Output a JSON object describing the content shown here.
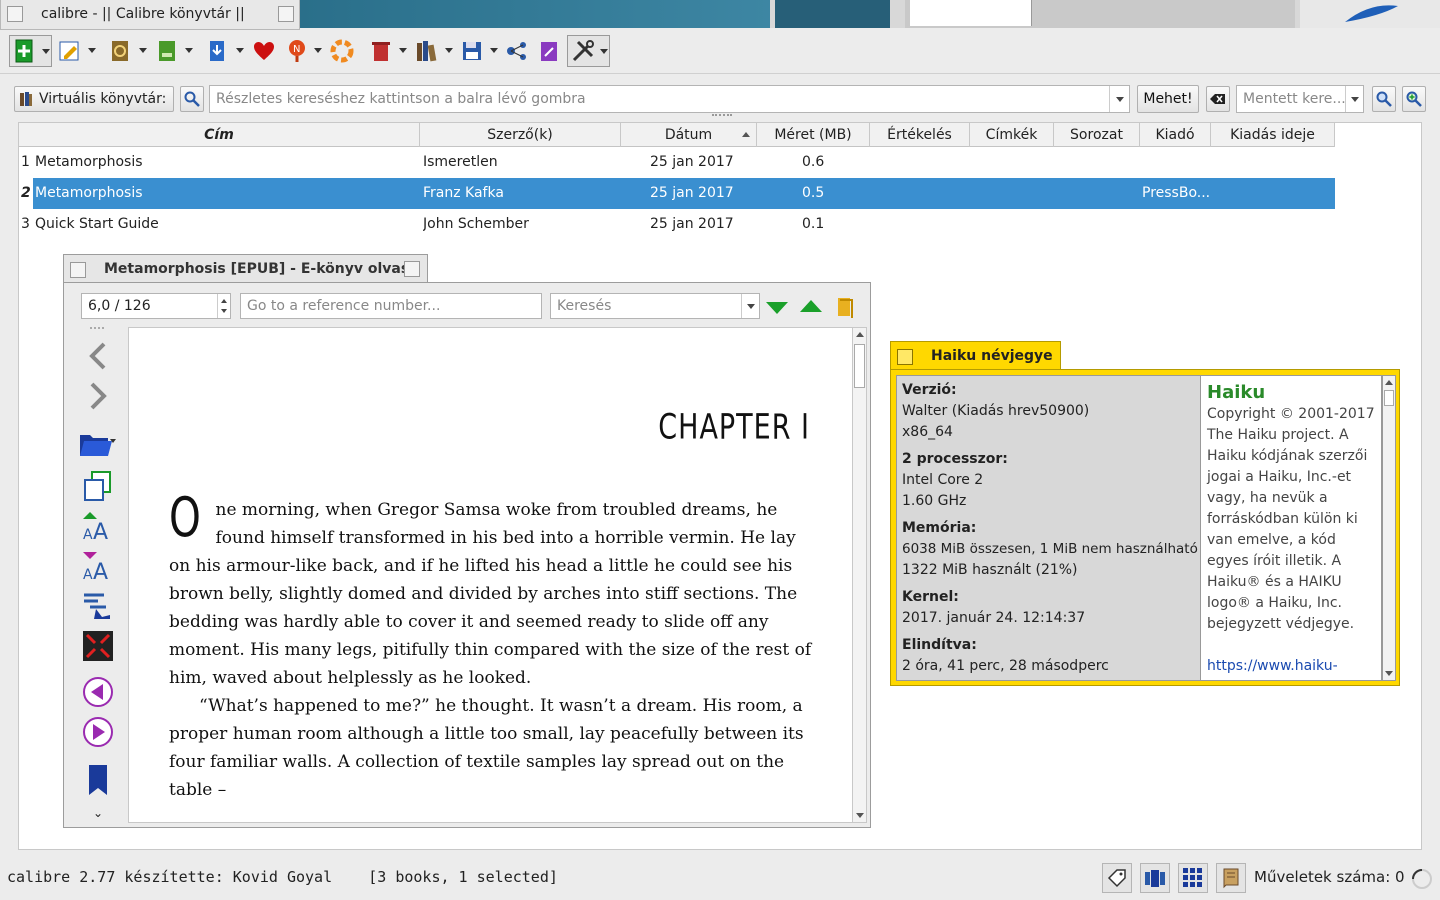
{
  "window": {
    "title": "calibre - || Calibre könyvtár ||"
  },
  "search": {
    "virtual_library_label": "Virtuális könyvtár:",
    "placeholder": "Részletes kereséshez kattintson a balra lévő gombra",
    "go_label": "Mehet!",
    "saved_placeholder": "Mentett kere..."
  },
  "table": {
    "columns": [
      "Cím",
      "Szerző(k)",
      "Dátum",
      "Méret (MB)",
      "Értékelés",
      "Címkék",
      "Sorozat",
      "Kiadó",
      "Kiadás ideje"
    ],
    "rows": [
      {
        "num": "1",
        "title": "Metamorphosis",
        "author": "Ismeretlen",
        "date": "25 jan 2017",
        "size": "0.6",
        "publisher": ""
      },
      {
        "num": "2",
        "title": "Metamorphosis",
        "author": "Franz Kafka",
        "date": "25 jan 2017",
        "size": "0.5",
        "publisher": "PressBo..."
      },
      {
        "num": "3",
        "title": "Quick Start Guide",
        "author": "John Schember",
        "date": "25 jan 2017",
        "size": "0.1",
        "publisher": ""
      }
    ]
  },
  "reader": {
    "title": "Metamorphosis [EPUB] - E-könyv olvasó",
    "position": "6,0 / 126",
    "reference_placeholder": "Go to a reference number...",
    "search_placeholder": "Keresés",
    "chapter": "CHAPTER I",
    "dropcap": "O",
    "para1": "ne morning, when Gregor Samsa woke from troubled dreams, he found himself transformed in his bed into a horrible vermin. He lay on his armour-like back, and if he lifted his head a little he could see his brown belly, slightly domed and divided by arches into stiff sections. The bedding was hardly able to cover it and seemed ready to slide off any moment. His many legs, pitifully thin compared with the size of the rest of him, waved about helplessly as he looked.",
    "para2": "“What’s happened to me?” he thought. It wasn’t a dream. His room, a proper human room although a little too small, lay peacefully between its four familiar walls. A collection of textile samples lay spread out on the table –"
  },
  "about": {
    "title": "Haiku névjegye",
    "version_label": "Verzió:",
    "version": "Walter (Kiadás hrev50900)",
    "arch": "x86_64",
    "cpu_label": "2 processzor:",
    "cpu": "Intel Core 2",
    "cpu_speed": "1.60 GHz",
    "memory_label": "Memória:",
    "memory_total": "6038 MiB összesen, 1 MiB nem használható",
    "memory_used": "1322 MiB használt (21%)",
    "kernel_label": "Kernel:",
    "kernel": "2017. január 24. 12:14:37",
    "uptime_label": "Elindítva:",
    "uptime": "2 óra, 41 perc, 28 másodperc",
    "app_name": "Haiku",
    "copyright": "Copyright © 2001-2017 The Haiku project. A Haiku kódjának szerzői jogai a Haiku, Inc.-et vagy, ha nevük a forráskódban külön ki van emelve, a kód egyes íróit illetik. A Haiku® és a HAIKU logo® a Haiku, Inc. bejegyzett védjegye.",
    "url": "https://www.haiku-os.org"
  },
  "status": {
    "left": "calibre 2.77 készítette: Kovid Goyal    [3 books, 1 selected]",
    "jobs": "Műveletek száma: 0"
  },
  "colors": {
    "selection": "#3a8fd0",
    "haiku_yellow": "#ffd800",
    "accent_green": "#1a9a2a"
  }
}
